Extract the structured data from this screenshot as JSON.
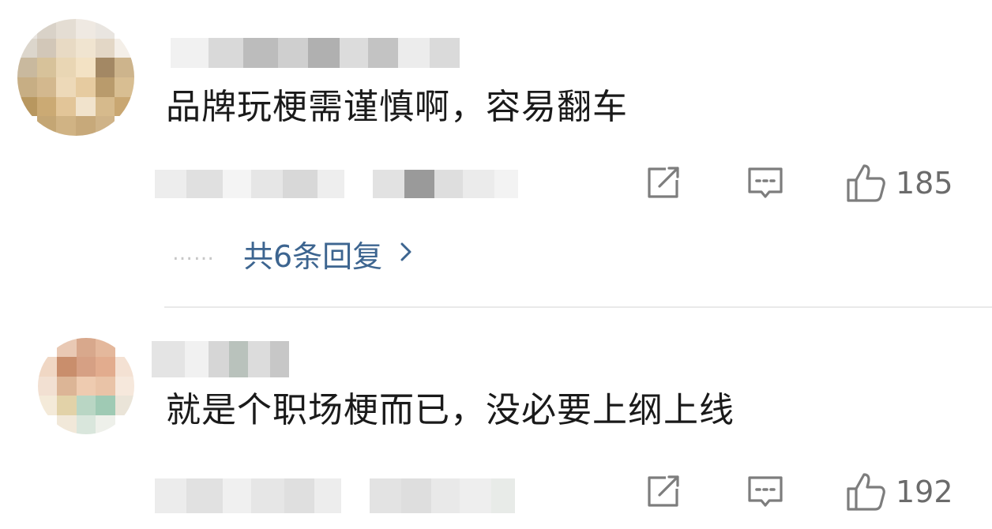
{
  "colors": {
    "text": "#1a1a1a",
    "meta": "#6b6b6b",
    "link": "#3d6590",
    "icon": "#7d7d7d",
    "divider": "#e9e9e9"
  },
  "comments": [
    {
      "text": "品牌玩梗需谨慎啊，容易翻车",
      "likes": "185",
      "replies_label": "共6条回复",
      "replies_dots": "……",
      "icons": {
        "share": "share-icon",
        "reply": "comment-icon",
        "like": "thumbs-up-icon",
        "more": "chevron-right-icon"
      }
    },
    {
      "text": "就是个职场梗而已，没必要上纲上线",
      "likes": "192",
      "icons": {
        "share": "share-icon",
        "reply": "comment-icon",
        "like": "thumbs-up-icon"
      }
    }
  ]
}
